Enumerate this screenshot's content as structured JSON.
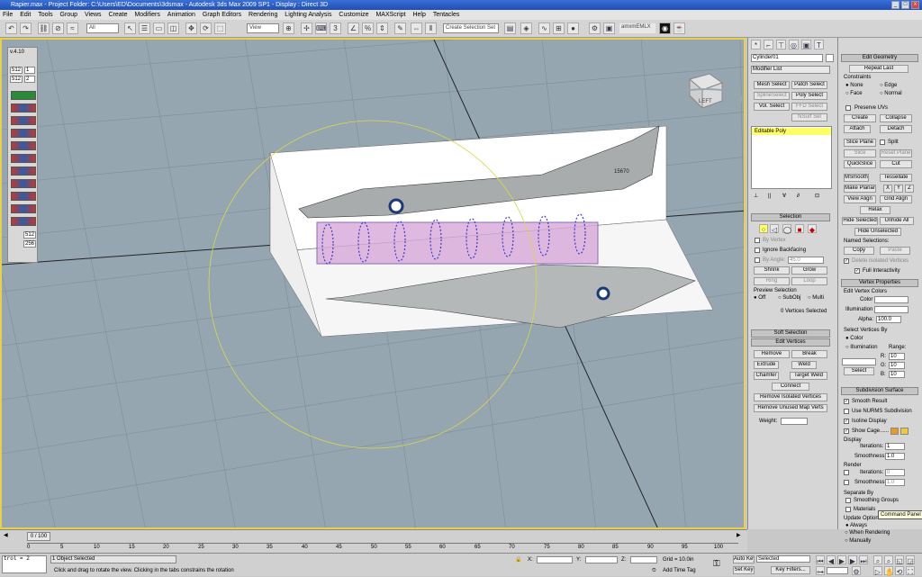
{
  "window": {
    "title": "Rapier.max - Project Folder: C:\\Users\\ED\\Documents\\3dsmax - Autodesk 3ds Max 2009 SP1 - Display : Direct 3D"
  },
  "menu": [
    "File",
    "Edit",
    "Tools",
    "Group",
    "Views",
    "Create",
    "Modifiers",
    "Animation",
    "Graph Editors",
    "Rendering",
    "Lighting Analysis",
    "Customize",
    "MAXScript",
    "Help",
    "Tentacles"
  ],
  "toolbar": {
    "filter": "All",
    "coord": "View",
    "selection_set": "Create Selection Set",
    "plugin": "amxmEMLX"
  },
  "viewport": {
    "viewcube_label": "LEFT",
    "plane_label": "15670"
  },
  "left_tool": {
    "version": "v.4.10",
    "v1": "512",
    "v2": "1",
    "v3": "512",
    "v4": "2",
    "v5": "512",
    "v6": "256"
  },
  "command_panel": {
    "object_name": "Cylinder01",
    "modifier_list": "Modifier List",
    "buttons": [
      "Mesh Select",
      "Patch Select",
      "SplineSelect",
      "Poly Select",
      "Vol. Select",
      "FFD Select",
      "NSurf Sel"
    ],
    "stack_item": "Editable Poly",
    "selection": {
      "title": "Selection",
      "by_vertex": "By Vertex",
      "ignore_backfacing": "Ignore Backfacing",
      "by_angle": "By Angle:",
      "angle": "45.0",
      "shrink": "Shrink",
      "grow": "Grow",
      "ring": "Ring",
      "loop": "Loop",
      "preview": "Preview Selection",
      "off": "Off",
      "subobj": "SubObj",
      "multi": "Multi",
      "status": "0 Vertices Selected"
    },
    "soft_selection": "Soft Selection",
    "edit_vertices": {
      "title": "Edit Vertices",
      "remove": "Remove",
      "break": "Break",
      "extrude": "Extrude",
      "weld": "Weld",
      "chamfer": "Chamfer",
      "target_weld": "Target Weld",
      "connect": "Connect",
      "remove_isolated": "Remove Isolated Vertices",
      "remove_unused": "Remove Unused Map Verts",
      "weight": "Weight:"
    }
  },
  "right_panel": {
    "edit_geometry": {
      "title": "Edit Geometry",
      "repeat_last": "Repeat Last",
      "constraints": "Constraints",
      "none": "None",
      "edge": "Edge",
      "face": "Face",
      "normal": "Normal",
      "preserve_uvs": "Preserve UVs",
      "create": "Create",
      "collapse": "Collapse",
      "attach": "Attach",
      "detach": "Detach",
      "slice_plane": "Slice Plane",
      "split": "Split",
      "slice": "Slice",
      "reset_plane": "Reset Plane",
      "quickslice": "QuickSlice",
      "cut": "Cut",
      "msmooth": "MSmooth",
      "tessellate": "Tessellate",
      "make_planar": "Make Planar",
      "x": "X",
      "y": "Y",
      "z": "Z",
      "view_align": "View Align",
      "grid_align": "Grid Align",
      "relax": "Relax",
      "hide_selected": "Hide Selected",
      "unhide_all": "Unhide All",
      "hide_unselected": "Hide Unselected",
      "named_sel": "Named Selections:",
      "copy": "Copy",
      "paste": "Paste",
      "delete_isolated": "Delete Isolated Vertices",
      "full_interactivity": "Full Interactivity"
    },
    "vertex_properties": {
      "title": "Vertex Properties",
      "edit_colors": "Edit Vertex Colors",
      "color": "Color",
      "illumination": "Illumination",
      "alpha": "Alpha:",
      "alpha_val": "100.0",
      "select_by": "Select Vertices By",
      "color_opt": "Color",
      "illum_opt": "Illumination",
      "range": "Range:",
      "r": "R:",
      "g": "G:",
      "b": "B:",
      "rv": "10",
      "gv": "10",
      "bv": "10",
      "select": "Select"
    },
    "subdivision": {
      "title": "Subdivision Surface",
      "smooth_result": "Smooth Result",
      "use_nurms": "Use NURMS Subdivision",
      "isoline": "Isoline Display",
      "show_cage": "Show Cage......",
      "display": "Display",
      "iterations": "Iterations:",
      "iter_val": "1",
      "smoothness": "Smoothness:",
      "smooth_val": "1.0",
      "render": "Render",
      "r_iter": "0",
      "r_smooth": "1.0",
      "separate_by": "Separate By",
      "smoothing_groups": "Smoothing Groups",
      "materials": "Materials",
      "update_options": "Update Options",
      "always": "Always",
      "when_rendering": "When Rendering",
      "manually": "Manually"
    },
    "tooltip": "Command Panel"
  },
  "timeline": {
    "frame": "0 / 100",
    "ticks": [
      "0",
      "5",
      "10",
      "15",
      "20",
      "25",
      "30",
      "35",
      "40",
      "45",
      "50",
      "55",
      "60",
      "65",
      "70",
      "75",
      "80",
      "85",
      "90",
      "95",
      "100"
    ]
  },
  "status": {
    "maxscript": "trol = 2",
    "selected": "1 Object Selected",
    "prompt": "Click and drag to rotate the view.  Clicking in the tabs constrains the rotation",
    "x": "X:",
    "y": "Y:",
    "z": "Z:",
    "grid": "Grid = 10.0in",
    "add_time_tag": "Add Time Tag",
    "auto_key": "Auto Key",
    "set_key": "Set Key",
    "key_mode": "Selected",
    "key_filters": "Key Filters..."
  },
  "colors": {
    "viewport_bg": "#95a6b1",
    "active_border": "#e8d04a",
    "stack_highlight": "#ffff66"
  }
}
